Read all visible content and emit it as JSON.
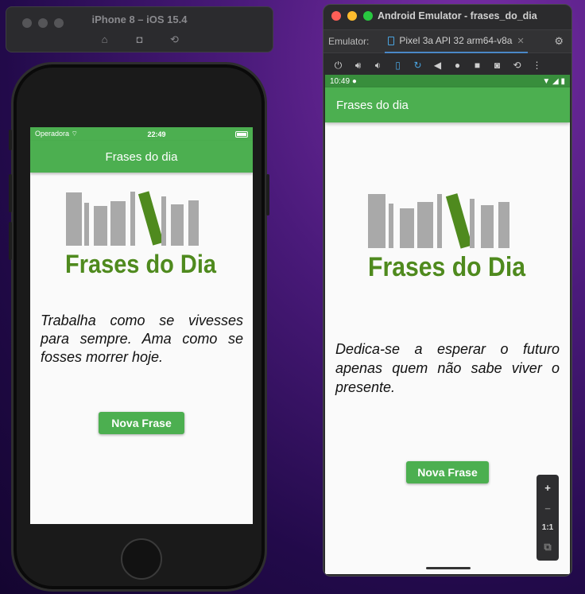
{
  "ios_simulator": {
    "window_title": "iPhone 8 – iOS 15.4",
    "toolbar_icons": [
      "home-icon",
      "screenshot-icon",
      "rotate-icon"
    ],
    "status_bar": {
      "carrier": "Operadora",
      "time": "22:49"
    },
    "app_bar_title": "Frases do dia",
    "logo_text": "Frases do Dia",
    "quote": "Trabalha como se vivesses para sempre. Ama como se fosses morrer hoje.",
    "button_label": "Nova Frase"
  },
  "android_emulator": {
    "window_title": "Android Emulator - frases_do_dia",
    "emulator_label": "Emulator:",
    "device_tab": "Pixel 3a API 32 arm64-v8a",
    "toolbar_icons": [
      "power-icon",
      "volume-up-icon",
      "volume-down-icon",
      "rotate-left-icon",
      "rotate-right-icon",
      "back-icon",
      "home-icon",
      "overview-icon",
      "camera-icon",
      "snapshot-icon",
      "more-icon"
    ],
    "status_bar": {
      "time": "10:49"
    },
    "app_bar_title": "Frases do dia",
    "logo_text": "Frases do Dia",
    "quote": "Dedica-se a esperar o futuro apenas quem não sabe viver o presente.",
    "button_label": "Nova Frase",
    "zoom_controls": {
      "zoom_in": "+",
      "zoom_out": "−",
      "actual_size": "1:1"
    }
  },
  "colors": {
    "primary_green": "#4caf50",
    "status_green": "#388e3c",
    "logo_dark_green": "#4f8a1e",
    "logo_gray": "#a9a9a9"
  }
}
